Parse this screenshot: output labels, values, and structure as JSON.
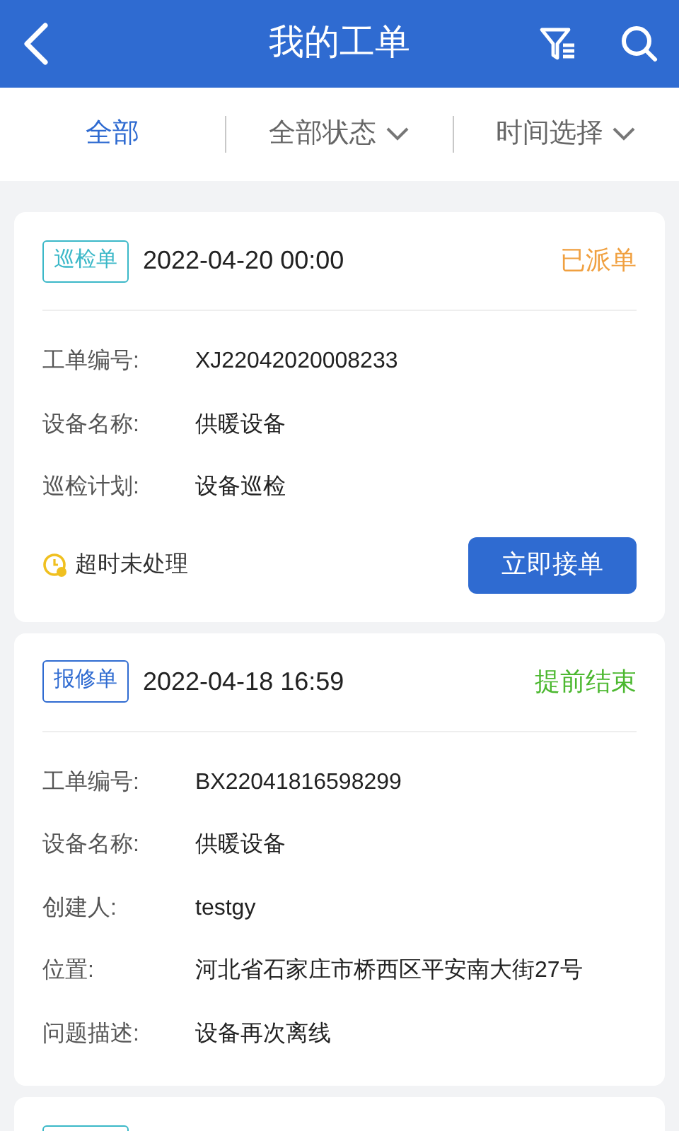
{
  "header": {
    "title": "我的工单"
  },
  "filters": [
    {
      "label": "全部",
      "selected": true,
      "dropdown": false
    },
    {
      "label": "全部状态",
      "selected": false,
      "dropdown": true
    },
    {
      "label": "时间选择",
      "selected": false,
      "dropdown": true
    }
  ],
  "orders": [
    {
      "tag": {
        "label": "巡检单",
        "color": "#3bb8c8"
      },
      "time": "2022-04-20 00:00",
      "status": {
        "label": "已派单",
        "color": "#f0a040"
      },
      "fields": [
        {
          "label": "工单编号:",
          "value": "XJ22042020008233"
        },
        {
          "label": "设备名称:",
          "value": "供暖设备"
        },
        {
          "label": "巡检计划:",
          "value": "设备巡检"
        }
      ],
      "warning": "超时未处理",
      "action": "立即接单"
    },
    {
      "tag": {
        "label": "报修单",
        "color": "#2f6bd1"
      },
      "time": "2022-04-18 16:59",
      "status": {
        "label": "提前结束",
        "color": "#4cb830"
      },
      "fields": [
        {
          "label": "工单编号:",
          "value": "BX22041816598299"
        },
        {
          "label": "设备名称:",
          "value": "供暖设备"
        },
        {
          "label": "创建人:",
          "value": "testgy"
        },
        {
          "label": "位置:",
          "value": "河北省石家庄市桥西区平安南大街27号"
        },
        {
          "label": "问题描述:",
          "value": "设备再次离线"
        }
      ]
    },
    {
      "tag": {
        "color": "#3bb8c8"
      }
    }
  ]
}
